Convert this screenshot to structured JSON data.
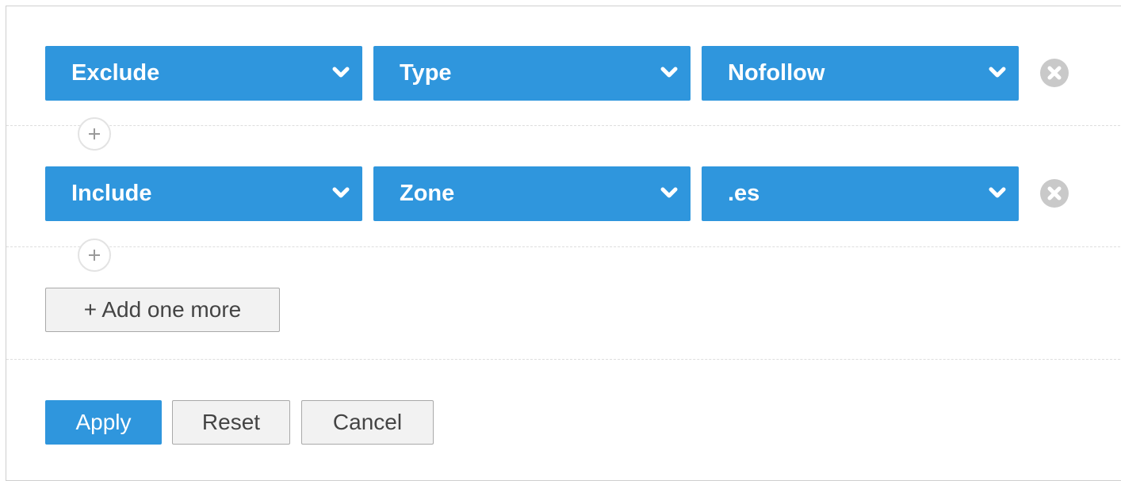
{
  "filters": [
    {
      "mode": "Exclude",
      "field": "Type",
      "value": "Nofollow"
    },
    {
      "mode": "Include",
      "field": "Zone",
      "value": ".es"
    }
  ],
  "actions": {
    "add_label": "+ Add one more",
    "apply_label": "Apply",
    "reset_label": "Reset",
    "cancel_label": "Cancel"
  },
  "icons": {
    "select_chevron": "chevron-down-icon",
    "remove": "remove-circle-icon",
    "insert": "plus-icon"
  },
  "colors": {
    "accent": "#2f96dd",
    "remove_icon": "#c9c9c9",
    "button_bg": "#f2f2f2",
    "button_border": "#a9a9a9"
  }
}
